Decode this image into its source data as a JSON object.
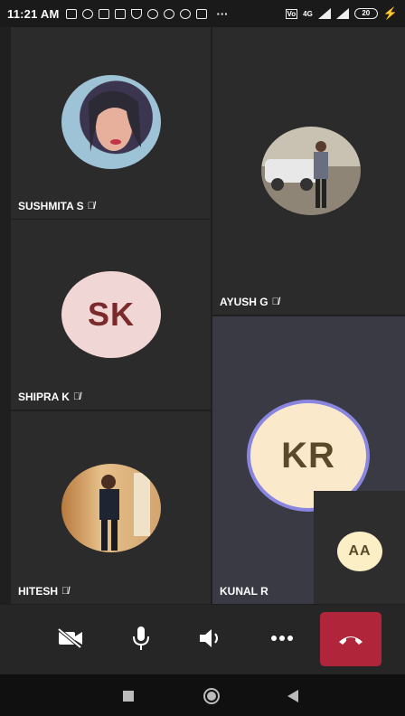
{
  "status_bar": {
    "time": "11:21 AM",
    "network": "4G",
    "battery": "20"
  },
  "participants": [
    {
      "name": "SUSHMITA S",
      "muted": true,
      "avatar": "photo"
    },
    {
      "name": "AYUSH G",
      "muted": true,
      "avatar": "photo"
    },
    {
      "name": "SHIPRA K",
      "muted": true,
      "initials": "SK"
    },
    {
      "name": "KUNAL R",
      "muted": false,
      "initials": "KR",
      "active_speaker": true
    },
    {
      "name": "HITESH",
      "muted": true,
      "avatar": "photo"
    },
    {
      "name": "",
      "initials": "AA",
      "self_view": true
    }
  ],
  "controls": [
    "camera-off-icon",
    "microphone-icon",
    "speaker-icon",
    "more-options-icon",
    "hang-up-icon"
  ],
  "navigation": [
    "recents-icon",
    "home-icon",
    "back-icon"
  ],
  "colors": {
    "hangup": "#b0253a",
    "sk_avatar": "#f1d6d6",
    "kr_avatar": "#fbe9cc",
    "aa_avatar": "#fcefc6",
    "active_ring": "#8a86e0"
  }
}
